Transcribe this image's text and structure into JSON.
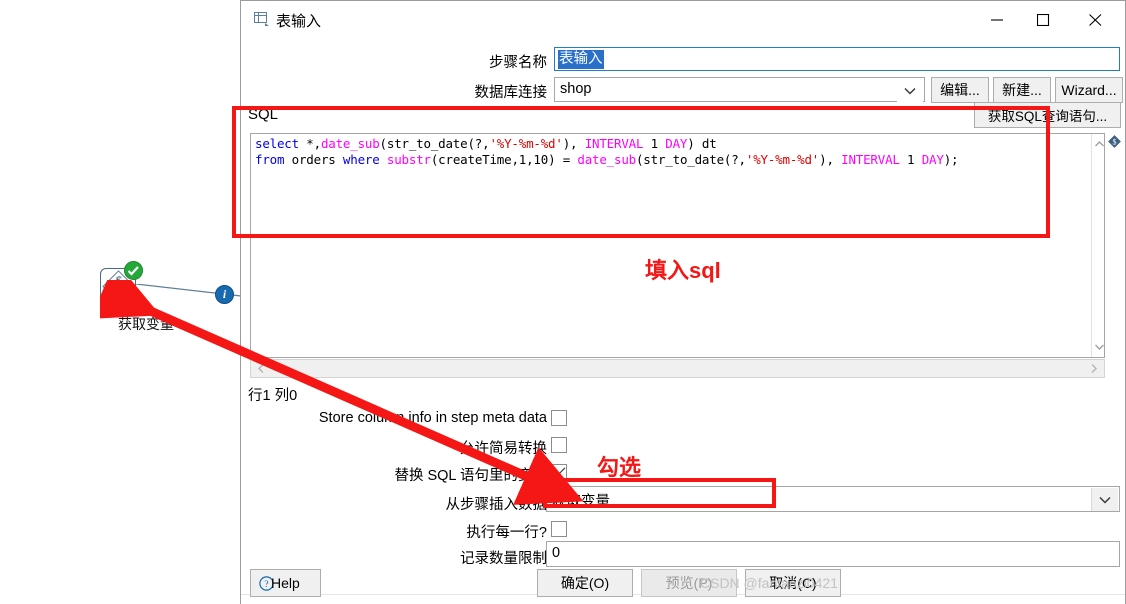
{
  "window": {
    "title": "表输入",
    "icon": "table-input-icon",
    "minimize": "minimize-icon",
    "maximize": "maximize-icon",
    "close": "close-icon"
  },
  "canvas": {
    "step": {
      "label": "获取变量",
      "icon": "get-variable-diamond-dollar-icon",
      "status_badge": "green-check-icon",
      "hop_badge": "blue-info-icon"
    }
  },
  "form": {
    "step_name_label": "步骤名称",
    "step_name_value": "表输入",
    "db_conn_label": "数据库连接",
    "db_conn_value": "shop",
    "edit_button": "编辑...",
    "new_button": "新建...",
    "wizard_button": "Wizard..."
  },
  "sql": {
    "group_label": "SQL",
    "get_sql_button": "获取SQL查询语句...",
    "status": "行1 列0",
    "lines": [
      [
        {
          "t": "select ",
          "c": "k"
        },
        {
          "t": "*,",
          "c": "p"
        },
        {
          "t": "date_sub",
          "c": "f"
        },
        {
          "t": "(str_to_date(?,",
          "c": "p"
        },
        {
          "t": "'%Y-%m-%d'",
          "c": "s"
        },
        {
          "t": "), ",
          "c": "p"
        },
        {
          "t": "INTERVAL",
          "c": "f"
        },
        {
          "t": " 1 ",
          "c": "p"
        },
        {
          "t": "DAY",
          "c": "f"
        },
        {
          "t": ") dt",
          "c": "p"
        }
      ],
      [
        {
          "t": "from ",
          "c": "k"
        },
        {
          "t": "orders ",
          "c": "p"
        },
        {
          "t": "where ",
          "c": "k"
        },
        {
          "t": "substr",
          "c": "f"
        },
        {
          "t": "(createTime,1,10) = ",
          "c": "p"
        },
        {
          "t": "date_sub",
          "c": "f"
        },
        {
          "t": "(str_to_date(?,",
          "c": "p"
        },
        {
          "t": "'%Y-%m-%d'",
          "c": "s"
        },
        {
          "t": "), ",
          "c": "p"
        },
        {
          "t": "INTERVAL",
          "c": "f"
        },
        {
          "t": " 1 ",
          "c": "p"
        },
        {
          "t": "DAY",
          "c": "f"
        },
        {
          "t": ");",
          "c": "p"
        }
      ]
    ]
  },
  "options": [
    {
      "label": "Store column info in step meta data",
      "checked": false
    },
    {
      "label": "允许简易转换",
      "checked": false
    },
    {
      "label": "替换 SQL 语句里的变量",
      "checked": true
    },
    {
      "label": "从步骤插入数据",
      "checked": null,
      "value": "获取变量"
    },
    {
      "label": "执行每一行?",
      "checked": false
    },
    {
      "label": "记录数量限制",
      "checked": null,
      "value": "0"
    }
  ],
  "buttons": {
    "help": "Help",
    "ok": "确定(O)",
    "preview": "预览(P)",
    "cancel": "取消(C)"
  },
  "annotations": {
    "fill_sql": "填入sql",
    "check_it": "勾选"
  },
  "watermark": "CSDN @fantaozi0421",
  "colors": {
    "annotation_red": "#f51616",
    "keyword_blue": "#0000e6",
    "function_magenta": "#ff00ff",
    "string_red": "#e00000",
    "selection_blue": "#2a6fc9",
    "status_green": "#24a83a",
    "info_blue": "#1769b0"
  }
}
